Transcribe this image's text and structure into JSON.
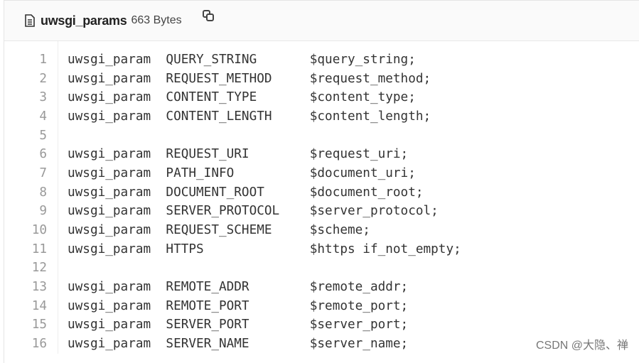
{
  "header": {
    "file_icon": "document-icon",
    "filename": "uwsgi_params",
    "size": "663 Bytes",
    "copy_icon": "copy-icon"
  },
  "lines": [
    {
      "n": "1",
      "text": "uwsgi_param  QUERY_STRING       $query_string;"
    },
    {
      "n": "2",
      "text": "uwsgi_param  REQUEST_METHOD     $request_method;"
    },
    {
      "n": "3",
      "text": "uwsgi_param  CONTENT_TYPE       $content_type;"
    },
    {
      "n": "4",
      "text": "uwsgi_param  CONTENT_LENGTH     $content_length;"
    },
    {
      "n": "5",
      "text": ""
    },
    {
      "n": "6",
      "text": "uwsgi_param  REQUEST_URI        $request_uri;"
    },
    {
      "n": "7",
      "text": "uwsgi_param  PATH_INFO          $document_uri;"
    },
    {
      "n": "8",
      "text": "uwsgi_param  DOCUMENT_ROOT      $document_root;"
    },
    {
      "n": "9",
      "text": "uwsgi_param  SERVER_PROTOCOL    $server_protocol;"
    },
    {
      "n": "10",
      "text": "uwsgi_param  REQUEST_SCHEME     $scheme;"
    },
    {
      "n": "11",
      "text": "uwsgi_param  HTTPS              $https if_not_empty;"
    },
    {
      "n": "12",
      "text": ""
    },
    {
      "n": "13",
      "text": "uwsgi_param  REMOTE_ADDR        $remote_addr;"
    },
    {
      "n": "14",
      "text": "uwsgi_param  REMOTE_PORT        $remote_port;"
    },
    {
      "n": "15",
      "text": "uwsgi_param  SERVER_PORT        $server_port;"
    },
    {
      "n": "16",
      "text": "uwsgi_param  SERVER_NAME        $server_name;"
    }
  ],
  "watermark": "CSDN @大隐、禅"
}
